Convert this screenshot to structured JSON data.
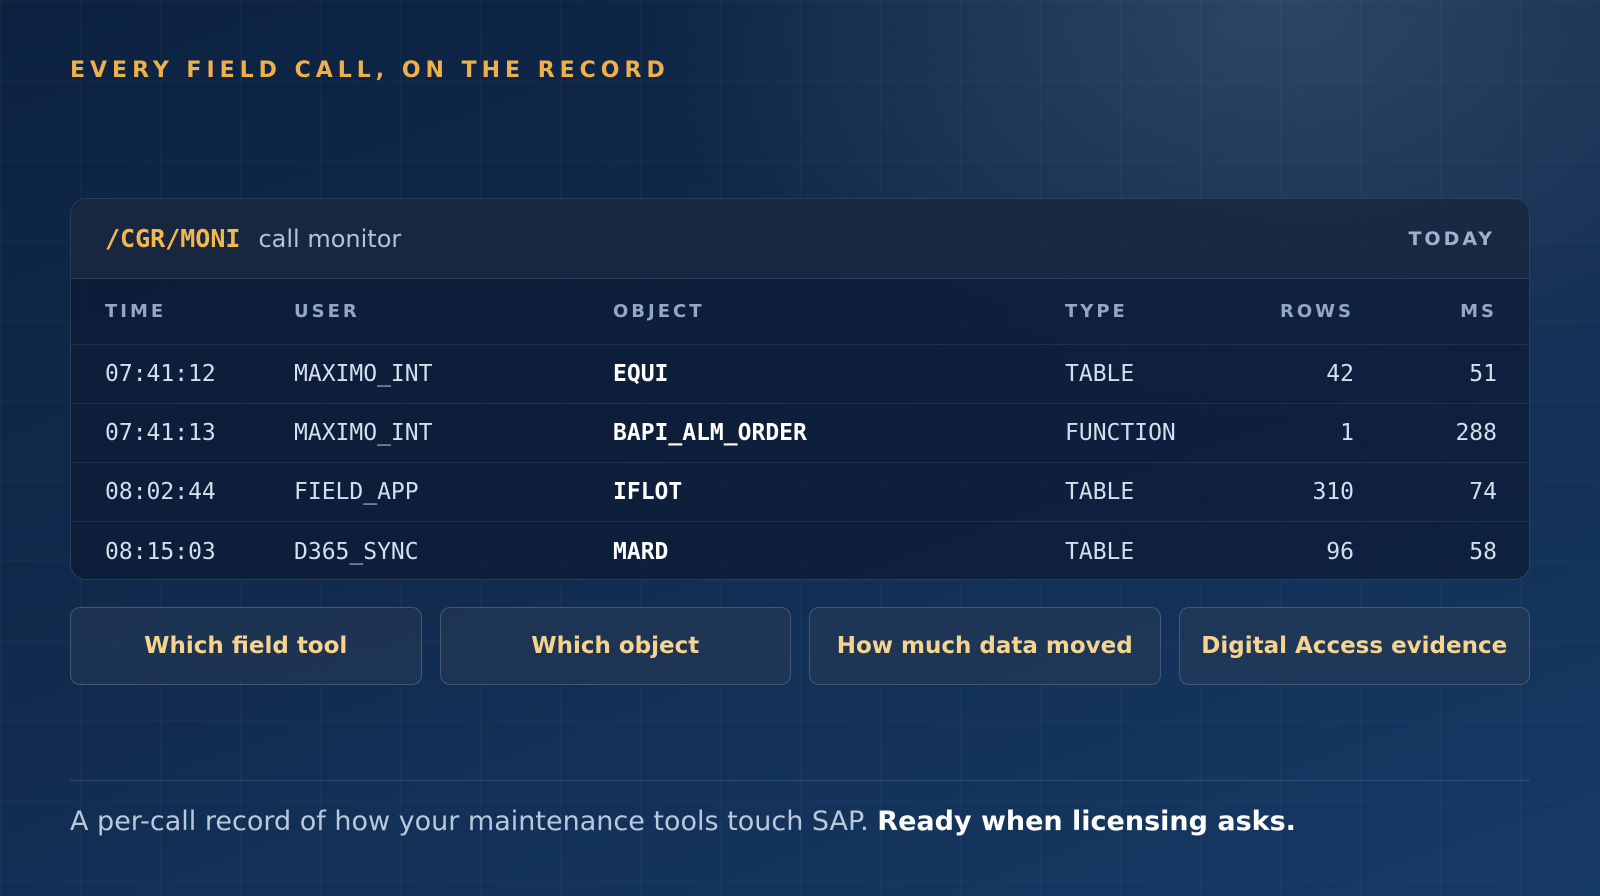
{
  "eyebrow": "EVERY FIELD CALL, ON THE RECORD",
  "panel": {
    "code": "/CGR/MONI",
    "subtitle": "call monitor",
    "date_label": "TODAY"
  },
  "table": {
    "headers": {
      "time": "TIME",
      "user": "USER",
      "object": "OBJECT",
      "type": "TYPE",
      "rows": "ROWS",
      "ms": "MS"
    },
    "rows": [
      {
        "time": "07:41:12",
        "user": "MAXIMO_INT",
        "object": "EQUI",
        "type": "TABLE",
        "rows": "42",
        "ms": "51"
      },
      {
        "time": "07:41:13",
        "user": "MAXIMO_INT",
        "object": "BAPI_ALM_ORDER",
        "type": "FUNCTION",
        "rows": "1",
        "ms": "288"
      },
      {
        "time": "08:02:44",
        "user": "FIELD_APP",
        "object": "IFLOT",
        "type": "TABLE",
        "rows": "310",
        "ms": "74"
      },
      {
        "time": "08:15:03",
        "user": "D365_SYNC",
        "object": "MARD",
        "type": "TABLE",
        "rows": "96",
        "ms": "58"
      }
    ]
  },
  "chips": [
    "Which field tool",
    "Which object",
    "How much data moved",
    "Digital Access evidence"
  ],
  "footer": {
    "text": "A per-call record of how your maintenance tools touch SAP.",
    "emphasis": "Ready when licensing asks."
  },
  "colors": {
    "accent": "#efb04a",
    "chip_text": "#f6d48e",
    "background": "#112a4b"
  }
}
